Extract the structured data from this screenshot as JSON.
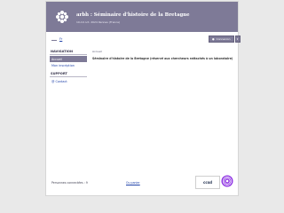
{
  "header": {
    "title": "arbh : Séminaire d'histoire de la Bretagne",
    "subtitle": "19-19 oct. 2024 Rennes (France)"
  },
  "lang": {
    "label": "Fr"
  },
  "user": {
    "button_label": "Connexion",
    "caret": "▾"
  },
  "sidebar": {
    "navigation_title": "NAVIGATION",
    "items": [
      {
        "label": "Accueil",
        "active": true
      },
      {
        "label": "Mon inscription",
        "active": false
      }
    ],
    "support_title": "SUPPORT",
    "support_items": [
      {
        "label": "@ Contact"
      }
    ]
  },
  "main": {
    "breadcrumb": "Accueil",
    "text": "Séminaire d'histoire de la Bretagne (réservé aux chercheurs rattachés à un laboratoire)"
  },
  "footer": {
    "online": "Personnes connectées : 9",
    "link": "Ou panier",
    "ccsd": "ccsd"
  },
  "colors": {
    "header": "#7e7a97",
    "link": "#2244aa",
    "background": "#e9e9e9"
  }
}
